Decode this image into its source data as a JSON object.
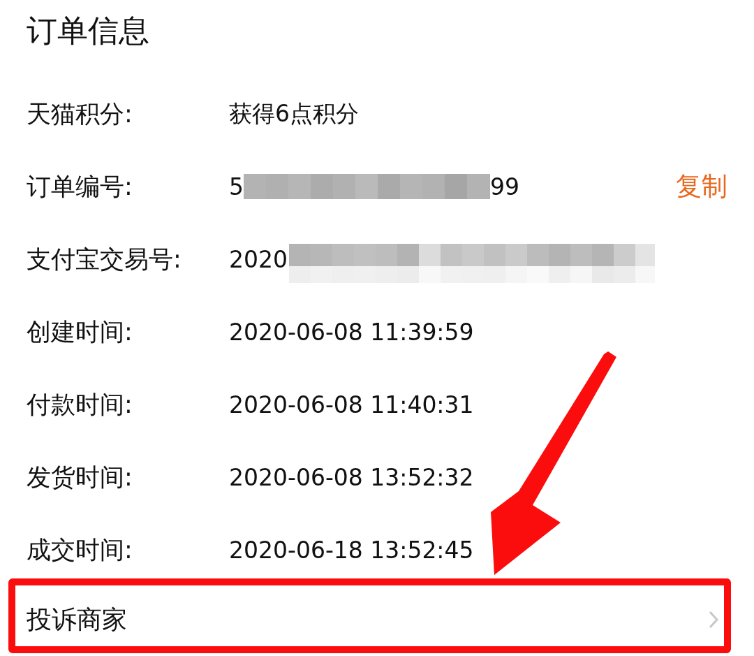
{
  "title": "订单信息",
  "fields": [
    {
      "kind": "text",
      "label": "天猫积分:",
      "value": "获得6点积分"
    },
    {
      "kind": "masked",
      "label": "订单编号:",
      "prefix": "5",
      "suffix": "99",
      "action": "复制"
    },
    {
      "kind": "masked",
      "label": "支付宝交易号:",
      "prefix": "2020"
    },
    {
      "kind": "text",
      "label": "创建时间:",
      "value": "2020-06-08 11:39:59"
    },
    {
      "kind": "text",
      "label": "付款时间:",
      "value": "2020-06-08 11:40:31"
    },
    {
      "kind": "text",
      "label": "发货时间:",
      "value": "2020-06-08 13:52:32"
    },
    {
      "kind": "text",
      "label": "成交时间:",
      "value": "2020-06-18 13:52:45"
    }
  ],
  "complaint": {
    "label": "投诉商家"
  }
}
